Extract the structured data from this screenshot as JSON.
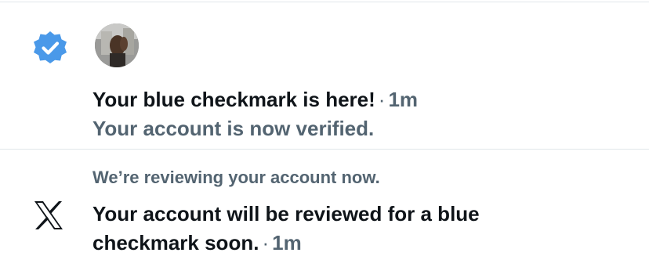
{
  "notifications": [
    {
      "icon": "verified-badge-icon",
      "title": "Your blue checkmark is here!",
      "separator": "·",
      "time": "1m",
      "subtitle": "Your account is now verified."
    },
    {
      "icon": "x-logo-icon",
      "preheader": "We’re reviewing your account now.",
      "message": "Your account will be reviewed for a blue checkmark soon.",
      "separator": "·",
      "time": "1m"
    }
  ],
  "colors": {
    "verified_blue": "#4a99e9",
    "secondary_text": "#536471",
    "primary_text": "#0f1419",
    "divider": "#e1e6ea"
  }
}
